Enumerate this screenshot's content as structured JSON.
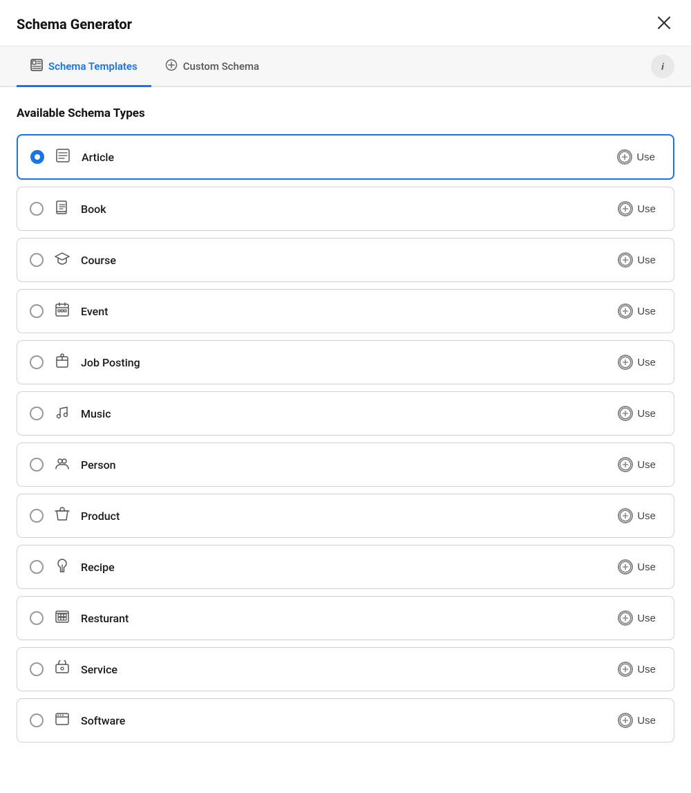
{
  "header": {
    "title": "Schema Generator",
    "close_label": "×"
  },
  "tabs": [
    {
      "id": "schema-templates",
      "label": "Schema Templates",
      "icon": "template-icon",
      "active": true
    },
    {
      "id": "custom-schema",
      "label": "Custom Schema",
      "icon": "plus-circle-icon",
      "active": false
    }
  ],
  "info_button_label": "i",
  "section_title": "Available Schema Types",
  "schema_types": [
    {
      "id": "article",
      "name": "Article",
      "icon": "article-icon",
      "selected": true
    },
    {
      "id": "book",
      "name": "Book",
      "icon": "book-icon",
      "selected": false
    },
    {
      "id": "course",
      "name": "Course",
      "icon": "course-icon",
      "selected": false
    },
    {
      "id": "event",
      "name": "Event",
      "icon": "event-icon",
      "selected": false
    },
    {
      "id": "job-posting",
      "name": "Job Posting",
      "icon": "job-posting-icon",
      "selected": false
    },
    {
      "id": "music",
      "name": "Music",
      "icon": "music-icon",
      "selected": false
    },
    {
      "id": "person",
      "name": "Person",
      "icon": "person-icon",
      "selected": false
    },
    {
      "id": "product",
      "name": "Product",
      "icon": "product-icon",
      "selected": false
    },
    {
      "id": "recipe",
      "name": "Recipe",
      "icon": "recipe-icon",
      "selected": false
    },
    {
      "id": "resturant",
      "name": "Resturant",
      "icon": "restaurant-icon",
      "selected": false
    },
    {
      "id": "service",
      "name": "Service",
      "icon": "service-icon",
      "selected": false
    },
    {
      "id": "software",
      "name": "Software",
      "icon": "software-icon",
      "selected": false
    }
  ],
  "use_label": "Use"
}
